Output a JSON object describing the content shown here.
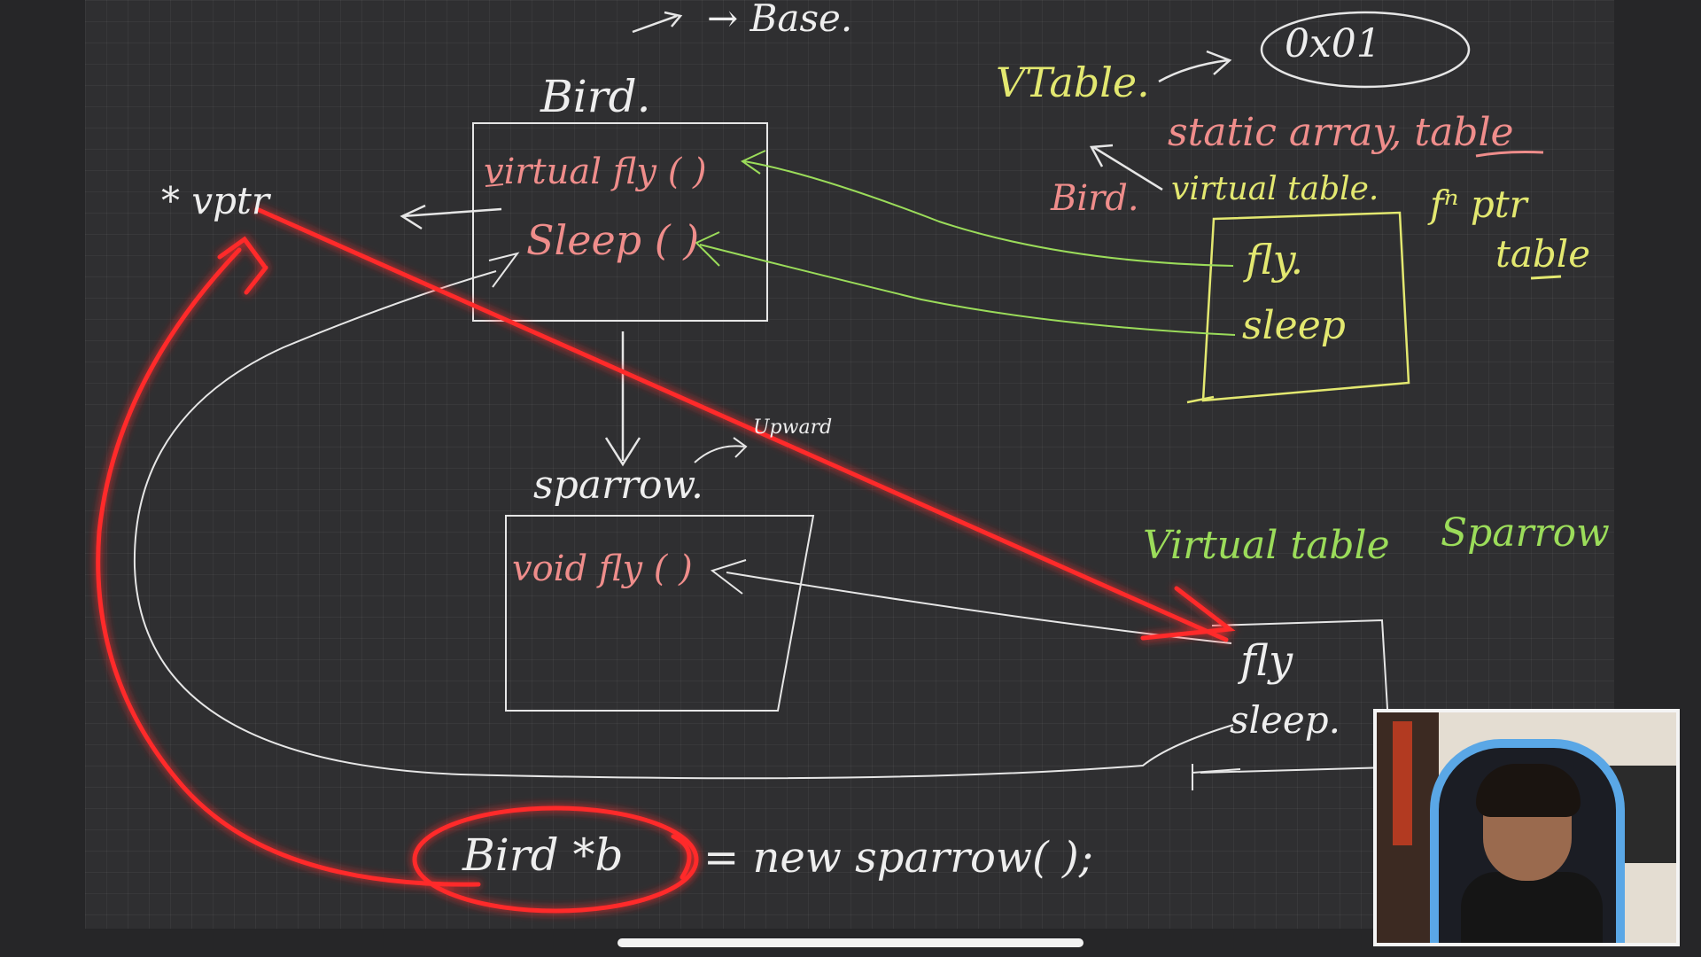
{
  "whiteboard": {
    "labels": {
      "base": "→ Base.",
      "bird_title": "Bird.",
      "vptr": "* vptr",
      "bird_method_fly": "virtual fly ( )",
      "bird_method_sleep": "Sleep ( )",
      "sparrow_title": "sparrow.",
      "sparrow_method_fly": "void fly ( )",
      "upward_note": "Upward",
      "code_line_object": "Bird *b",
      "code_line_rest": "= new sparrow( );",
      "vtable_label": "VTable.",
      "address": "0x01",
      "static_array": "static array, table",
      "bird_vt_owner": "Bird.",
      "virtual_table": "virtual table.",
      "fn_ptr": "fⁿ ptr",
      "fn_table": "table",
      "bird_vt_fly": "fly.",
      "bird_vt_sleep": "sleep",
      "sparrow_vt_title": "Virtual table",
      "sparrow_vt_owner": "Sparrow",
      "sparrow_vt_fly": "fly",
      "sparrow_vt_sleep": "sleep."
    },
    "colors": {
      "board": "#2f2f31",
      "chalk_white": "#eeeeee",
      "pink": "#ef8d8b",
      "yellow": "#e3e870",
      "green": "#9bdc5a",
      "laser_red": "#ff2a2a"
    }
  },
  "webcam": {
    "subject": "presenter in gaming chair"
  }
}
